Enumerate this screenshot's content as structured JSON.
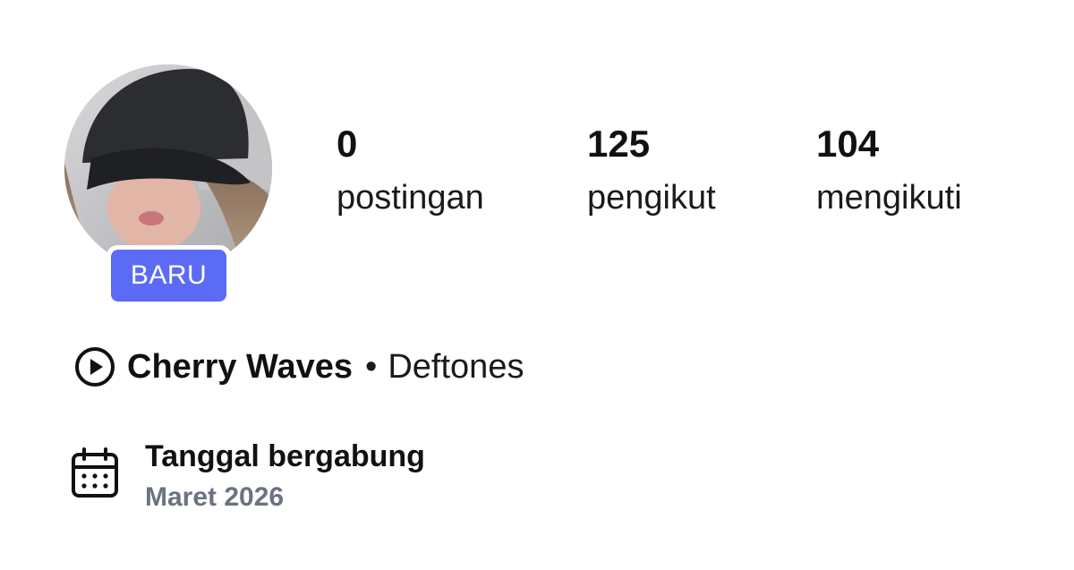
{
  "profile": {
    "badge": "BARU"
  },
  "stats": {
    "posts": {
      "count": "0",
      "label": "postingan"
    },
    "followers": {
      "count": "125",
      "label": "pengikut"
    },
    "following": {
      "count": "104",
      "label": "mengikuti"
    }
  },
  "music": {
    "title": "Cherry Waves",
    "separator": "•",
    "artist": "Deftones",
    "icon": "play-circle-icon"
  },
  "joined": {
    "label": "Tanggal bergabung",
    "value": "Maret 2026",
    "icon": "calendar-icon"
  },
  "colors": {
    "badge": "#5b6bf5",
    "muted_text": "#6b7280",
    "text": "#111111"
  }
}
